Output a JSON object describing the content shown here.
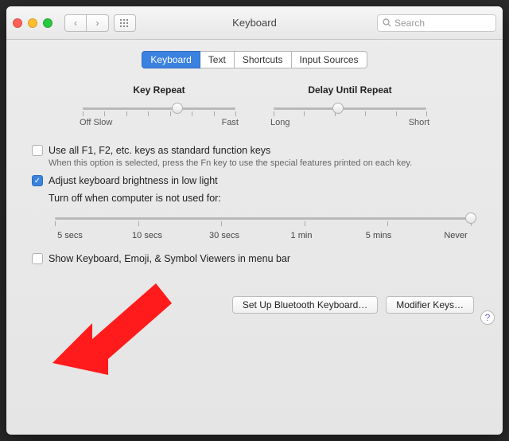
{
  "window": {
    "title": "Keyboard"
  },
  "search": {
    "placeholder": "Search"
  },
  "tabs": [
    "Keyboard",
    "Text",
    "Shortcuts",
    "Input Sources"
  ],
  "activeTab": 0,
  "keyRepeat": {
    "label": "Key Repeat",
    "leftLabel": "Off Slow",
    "rightLabel": "Fast",
    "ticks": 8,
    "pos": 0.62
  },
  "delayRepeat": {
    "label": "Delay Until Repeat",
    "leftLabel": "Long",
    "rightLabel": "Short",
    "ticks": 6,
    "pos": 0.42
  },
  "useFKeys": {
    "checked": false,
    "label": "Use all F1, F2, etc. keys as standard function keys",
    "hint": "When this option is selected, press the Fn key to use the special features printed on each key."
  },
  "adjustBrightness": {
    "checked": true,
    "label": "Adjust keyboard brightness in low light"
  },
  "turnOff": {
    "label": "Turn off when computer is not used for:",
    "pos": 1.0,
    "ticks": [
      "5 secs",
      "10 secs",
      "30 secs",
      "1 min",
      "5 mins",
      "Never"
    ]
  },
  "showViewers": {
    "checked": false,
    "label": "Show Keyboard, Emoji, & Symbol Viewers in menu bar"
  },
  "buttons": {
    "bluetooth": "Set Up Bluetooth Keyboard…",
    "modifier": "Modifier Keys…"
  }
}
